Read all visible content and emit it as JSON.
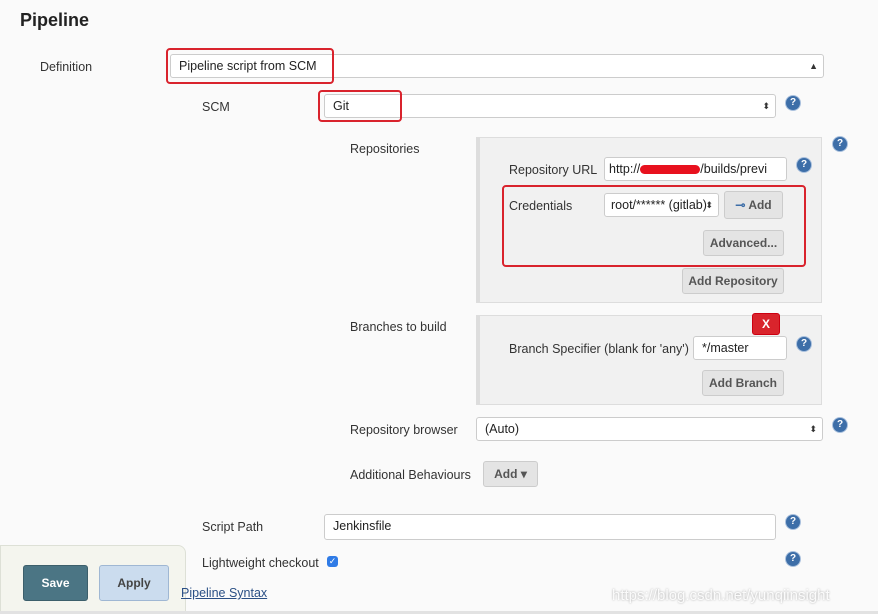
{
  "section_title": "Pipeline",
  "definition": {
    "label": "Definition",
    "value": "Pipeline script from SCM"
  },
  "scm": {
    "label": "SCM",
    "value": "Git"
  },
  "repositories": {
    "label": "Repositories",
    "url_label": "Repository URL",
    "url_value_prefix": "http://",
    "url_value_suffix": "/builds/previ",
    "credentials_label": "Credentials",
    "credentials_value": "root/****** (gitlab)",
    "add_button": "Add",
    "advanced_button": "Advanced...",
    "add_repository_button": "Add Repository"
  },
  "branches": {
    "label": "Branches to build",
    "delete_button": "X",
    "specifier_label": "Branch Specifier (blank for 'any')",
    "specifier_value": "*/master",
    "add_branch_button": "Add Branch"
  },
  "repo_browser": {
    "label": "Repository browser",
    "value": "(Auto)"
  },
  "additional": {
    "label": "Additional Behaviours",
    "add_button": "Add"
  },
  "script_path": {
    "label": "Script Path",
    "value": "Jenkinsfile"
  },
  "lightweight": {
    "label": "Lightweight checkout",
    "checked": true
  },
  "pipeline_syntax_link": "Pipeline Syntax",
  "footer": {
    "save": "Save",
    "apply": "Apply"
  },
  "watermark": "https://blog.csdn.net/yunqiinsight",
  "help": "?"
}
